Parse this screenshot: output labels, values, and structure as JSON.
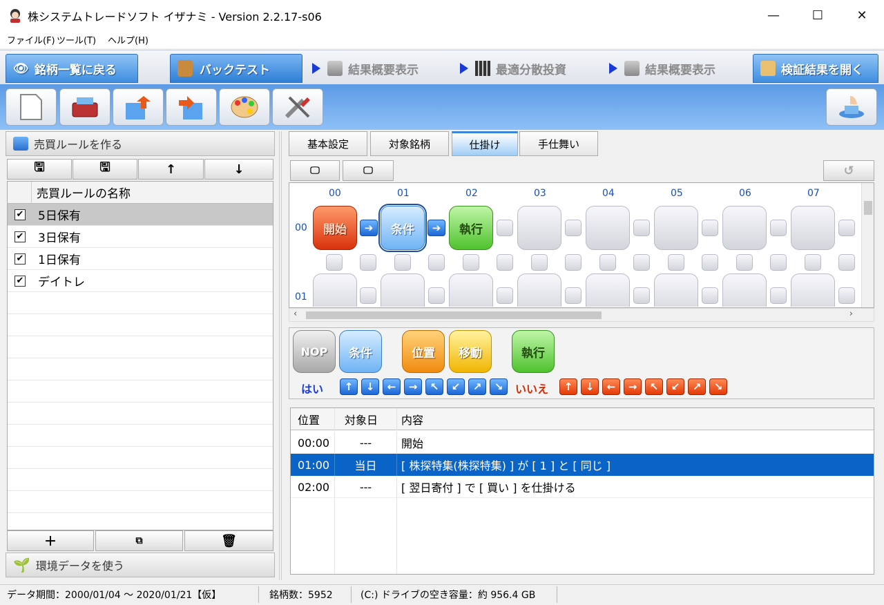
{
  "window": {
    "title": "株システムトレードソフト イザナミ - Version 2.2.17-s06",
    "minimize": "—",
    "maximize": "☐",
    "close": "✕"
  },
  "menu": [
    "ファイル(F)",
    "ツール(T)",
    "ヘルプ(H)"
  ],
  "nav": {
    "back": "銘柄一覧に戻る",
    "backtest": "バックテスト",
    "summary1": "結果概要表示",
    "portfolio": "最適分散投資",
    "summary2": "結果概要表示",
    "open_results": "検証結果を開く"
  },
  "left": {
    "header": "売買ルールを作る",
    "column_header": "売買ルールの名称",
    "rules": [
      {
        "name": "5日保有",
        "checked": true
      },
      {
        "name": "3日保有",
        "checked": true
      },
      {
        "name": "1日保有",
        "checked": true
      },
      {
        "name": "デイトレ",
        "checked": true
      }
    ],
    "footer": "環境データを使う"
  },
  "subtabs": [
    "基本設定",
    "対象銘柄",
    "仕掛け",
    "手仕舞い"
  ],
  "grid": {
    "columns": [
      "00",
      "01",
      "02",
      "03",
      "04",
      "05",
      "06",
      "07"
    ],
    "rows": [
      "00",
      "01"
    ],
    "start": "開始",
    "condition": "条件",
    "execute": "執行"
  },
  "palette": {
    "nop": "NOP",
    "condition": "条件",
    "position": "位置",
    "move": "移動",
    "execute": "執行",
    "yes": "はい",
    "no": "いいえ"
  },
  "detail": {
    "headers": [
      "位置",
      "対象日",
      "内容"
    ],
    "rows": [
      [
        "00:00",
        "---",
        "開始"
      ],
      [
        "01:00",
        "当日",
        "[ 株探特集(株探特集) ] が [ 1 ] と [ 同じ ]"
      ],
      [
        "02:00",
        "---",
        "[ 翌日寄付 ] で [ 買い ] を仕掛ける"
      ]
    ],
    "selected_row": 1
  },
  "status": {
    "period": "データ期間：2000/01/04 〜 2020/01/21【仮】",
    "count": "銘柄数：5952",
    "disk": "(C:) ドライブの空き容量：約 956.4 GB"
  }
}
